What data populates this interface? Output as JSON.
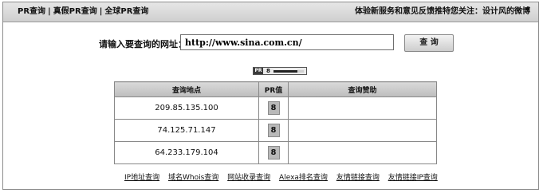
{
  "topbar": {
    "nav": [
      "PR查询",
      "真假PR查询",
      "全球PR查询"
    ],
    "separators": [
      "|",
      "|"
    ],
    "notice": "体验新服务和意见反馈推特您关注：设计风的微博"
  },
  "query": {
    "label": "请输入要查询的网址：",
    "url_value": "http://www.sina.com.cn/",
    "button_label": "查 询"
  },
  "pr_badge": {
    "tag": "PR",
    "value": "8",
    "fill_fraction": 0.8
  },
  "results": {
    "headers": [
      "查询地点",
      "PR值",
      "查询赞助"
    ],
    "rows": [
      {
        "ip": "209.85.135.100",
        "pr": "8",
        "sponsor": ""
      },
      {
        "ip": "74.125.71.147",
        "pr": "8",
        "sponsor": ""
      },
      {
        "ip": "64.233.179.104",
        "pr": "8",
        "sponsor": ""
      }
    ]
  },
  "footer_links": [
    "IP地址查询",
    "域名Whois查询",
    "网站收录查询",
    "Alexa排名查询",
    "友情链接查询",
    "友情链接IP查询"
  ]
}
